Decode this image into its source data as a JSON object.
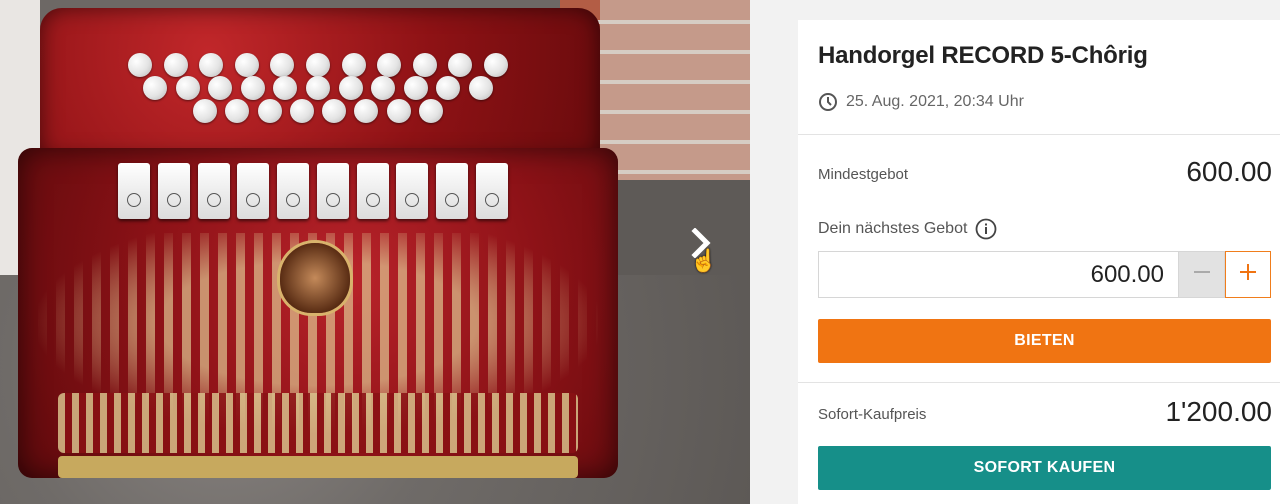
{
  "gallery": {
    "image_alt": "Handorgel RECORD 5-Chôrig",
    "next_icon": "chevron-right-icon",
    "cursor_icon": "hand-pointer-icon"
  },
  "listing": {
    "title": "Handorgel RECORD 5-Chôrig",
    "date": "25. Aug. 2021, 20:34 Uhr",
    "date_icon": "clock-icon"
  },
  "bidding": {
    "min_bid_label": "Mindestgebot",
    "min_bid_value": "600.00",
    "next_bid_label": "Dein nächstes Gebot",
    "info_icon": "info-icon",
    "next_bid_value": "600.00",
    "decrement_icon": "minus-icon",
    "increment_icon": "plus-icon",
    "bid_button": "BIETEN"
  },
  "buy_now": {
    "label": "Sofort-Kaufpreis",
    "value": "1'200.00",
    "button": "SOFORT KAUFEN"
  },
  "colors": {
    "accent_orange": "#f07412",
    "accent_teal": "#168f89"
  }
}
